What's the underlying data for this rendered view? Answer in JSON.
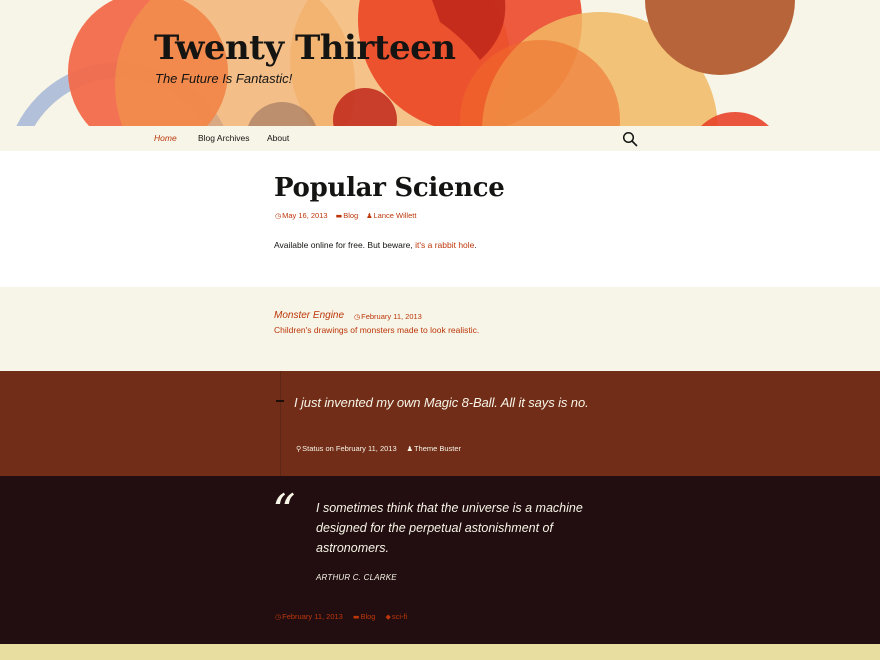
{
  "site": {
    "title": "Twenty Thirteen",
    "description": "The Future Is Fantastic!"
  },
  "nav": {
    "items": [
      {
        "label": "Home",
        "current": true
      },
      {
        "label": "Blog Archives",
        "current": false
      },
      {
        "label": "About",
        "current": false
      }
    ]
  },
  "post1": {
    "title": "Popular Science",
    "date": "May 16, 2013",
    "category": "Blog",
    "author": "Lance Willett",
    "text_before": "Available online for free. But beware, ",
    "link_text": "it's a rabbit hole",
    "text_after": "."
  },
  "post2": {
    "title": "Monster Engine",
    "date": "February 11, 2013",
    "text": "Children's drawings of monsters made to look realistic."
  },
  "post3": {
    "text": "I just invented my own Magic 8-Ball. All it says is no.",
    "status": "Status on February 11, 2013",
    "author": "Theme Buster"
  },
  "post4": {
    "quote_mark": "“",
    "quote": "I sometimes think that the universe is a machine designed for the perpetual astonishment of astronomers.",
    "cite": "ARTHUR C. CLARKE",
    "date": "February 11, 2013",
    "category": "Blog",
    "tag": "sci-fi"
  },
  "icons": {
    "clock": "◷",
    "folder": "▬",
    "user": "♟",
    "pin": "⚲",
    "tag": "◆"
  },
  "colors": {
    "accent": "#bc360a",
    "status_bg": "#722d19",
    "quote_bg": "#220e10",
    "header_bg": "#f7f5e7"
  }
}
